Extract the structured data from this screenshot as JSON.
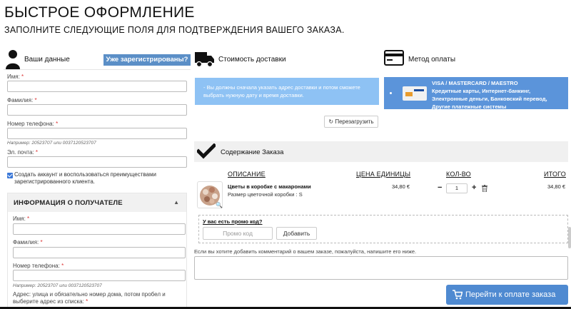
{
  "page": {
    "title": "БЫСТРОЕ ОФОРМЛЕНИЕ",
    "subtitle": "ЗАПОЛНИТЕ СЛЕДУЮЩИЕ ПОЛЯ ДЛЯ ПОДТВЕРЖДЕНИЯ ВАШЕГО ЗАКАЗА."
  },
  "customer": {
    "header": "Ваши данные",
    "registered_button": "Уже зарегистрированы?",
    "first_name_label": "Имя:",
    "last_name_label": "Фамилия:",
    "phone_label": "Номер телефона:",
    "phone_hint": "Например: 20523707 или 0037120523707",
    "email_label": "Эл. почта:",
    "create_account_text": "Создать аккаунт и воспользоваться преимуществами зарегистрированного клиента.",
    "create_account_checked": true,
    "required_mark": "*"
  },
  "recipient": {
    "header": "ИНФОРМАЦИЯ О ПОЛУЧАТЕЛЕ",
    "first_name_label": "Имя:",
    "last_name_label": "Фамилия:",
    "phone_label": "Номер телефона:",
    "phone_hint": "Например: 20523707 или 0037120523707",
    "address_label": "Адрес: улица и обязательно номер дома, потом пробел и выберите адрес из списка:"
  },
  "delivery": {
    "header": "Стоимость доставки",
    "note": "- Вы должны сначала указать адрес доставки и потом сможете выбрать нужную дату и время доставки.",
    "reload_button": "Перезагрузить"
  },
  "payment": {
    "header": "Метод оплаты",
    "option_title": "VISA / MASTERCARD / MAESTRO",
    "option_desc": "Кредитные карты, Интернет-банкинг, Электронные деньги, Банковский перевод, Другие платежные системы"
  },
  "order": {
    "header": "Содержание Заказа",
    "columns": {
      "description": "ОПИСАНИЕ",
      "unit_price": "ЦЕНА ЕДИНИЦЫ",
      "quantity": "КОЛ-ВО",
      "total": "ИТОГО"
    },
    "items": [
      {
        "name": "Цветы в коробке с макаронами",
        "size": "Размер цветочной коробки : S",
        "unit_price": "34,80 €",
        "quantity": "1",
        "total": "34,80 €"
      }
    ],
    "qty_minus": "−",
    "qty_plus": "+"
  },
  "promo": {
    "question": "У вас есть промо код?",
    "placeholder": "Промо код",
    "apply_button": "Добавить"
  },
  "comment": {
    "hint": "Если вы хотите добавить комментарий о вашем заказе, пожалуйста, напишите его ниже."
  },
  "checkout": {
    "button": "Перейти к оплате заказа"
  },
  "colors": {
    "accent": "#5b8fc7",
    "note_bg": "#8ec2f4",
    "payment_bg": "#5b94da",
    "checkout_bg": "#4f8ad1"
  },
  "icons": [
    "user-icon",
    "truck-icon",
    "credit-card-icon",
    "checkmark-icon",
    "reload-icon",
    "zoom-icon",
    "trash-icon",
    "cart-icon",
    "chevron-up-icon"
  ]
}
